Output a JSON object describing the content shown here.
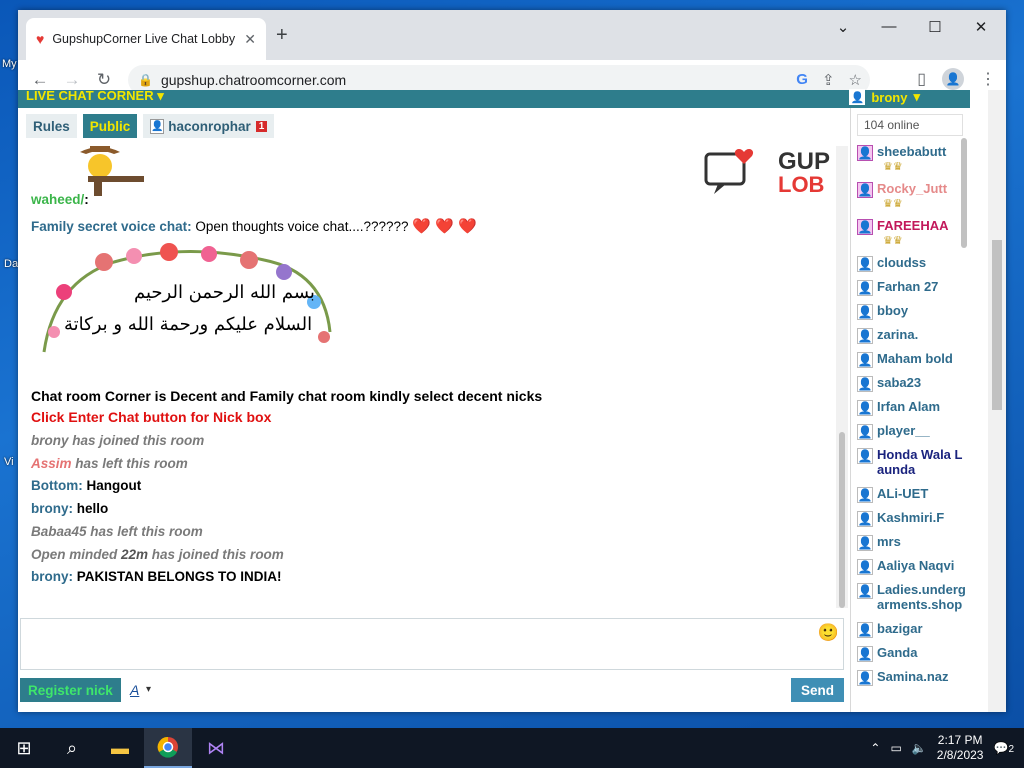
{
  "desktop": {
    "labels": [
      "My",
      "Da",
      "Vi"
    ]
  },
  "browser": {
    "tab_title": "GupshupCorner Live Chat Lobby",
    "url": "gupshup.chatroomcorner.com"
  },
  "site": {
    "brand": "LIVE CHAT CORNER",
    "current_user": "brony",
    "logo_text_top": "GUP",
    "logo_text_bottom": "LOB"
  },
  "chat_tabs": [
    {
      "label": "Rules"
    },
    {
      "label": "Public",
      "active": true
    },
    {
      "label": "haconrophar",
      "badge": "1"
    }
  ],
  "messages": [
    {
      "nick": "waheed/",
      "sep": ":",
      "text": ""
    },
    {
      "nick": "Family secret voice chat",
      "sep": ":",
      "text": " Open thoughts voice chat....??????",
      "extra": "❤️ ❤️ ❤️"
    },
    {
      "text": "Chat room Corner is Decent and Family chat room kindly select decent nicks"
    },
    {
      "text": "Click Enter Chat button for Nick box"
    },
    {
      "text": "brony has joined this room"
    },
    {
      "nick": "Assim",
      "text": " has left this room"
    },
    {
      "nick": "Bottom",
      "sep": ":",
      "text": " Hangout"
    },
    {
      "nick": "brony",
      "sep": ":",
      "text": " hello"
    },
    {
      "text": "Babaa45 has left this room"
    },
    {
      "pre": "Open minded ",
      "bold": "22m",
      "text": " has joined this room"
    },
    {
      "nick": "brony",
      "sep": ":",
      "text": " PAKISTAN BELONGS TO INDIA!"
    }
  ],
  "image_text": {
    "line1": "بسم الله الرحمن الرحیم",
    "line2": "السلام علیکم ورحمة الله و برکاتة"
  },
  "compose": {
    "register_label": "Register nick",
    "font_label": "A",
    "send_label": "Send"
  },
  "userlist": {
    "online_count": "104 online",
    "users": [
      {
        "name": "sheebabutt",
        "gender": "female",
        "crown": true,
        "color": "#2f6b8c"
      },
      {
        "name": "Rocky_Jutt",
        "gender": "female",
        "crown": true,
        "color": "#e58a8a"
      },
      {
        "name": "FAREEHAA",
        "gender": "female",
        "crown": true,
        "color": "#c2185b"
      },
      {
        "name": "cloudss",
        "gender": "male",
        "color": "#2f6b8c"
      },
      {
        "name": "Farhan 27",
        "gender": "male",
        "color": "#2f6b8c"
      },
      {
        "name": "bboy",
        "gender": "male",
        "color": "#2f6b8c"
      },
      {
        "name": "zarina.",
        "gender": "male",
        "color": "#2f6b8c"
      },
      {
        "name": "Maham bold",
        "gender": "male",
        "color": "#2f6b8c"
      },
      {
        "name": "saba23",
        "gender": "male",
        "color": "#2f6b8c"
      },
      {
        "name": "Irfan Alam",
        "gender": "male",
        "color": "#2f6b8c"
      },
      {
        "name": "player__",
        "gender": "male",
        "color": "#2f6b8c"
      },
      {
        "name": "Honda Wala Launda",
        "gender": "male",
        "color": "#1a237e"
      },
      {
        "name": "ALi-UET",
        "gender": "male",
        "color": "#2f6b8c"
      },
      {
        "name": "Kashmiri.F",
        "gender": "male",
        "color": "#2f6b8c"
      },
      {
        "name": "mrs",
        "gender": "male",
        "color": "#2f6b8c"
      },
      {
        "name": "Aaliya Naqvi",
        "gender": "male",
        "color": "#2f6b8c"
      },
      {
        "name": "Ladies.undergarments.shop",
        "gender": "male",
        "color": "#2f6b8c"
      },
      {
        "name": "bazigar",
        "gender": "male",
        "color": "#2f6b8c"
      },
      {
        "name": "Ganda",
        "gender": "male",
        "color": "#2f6b8c"
      },
      {
        "name": "Samina.naz",
        "gender": "male",
        "color": "#2f6b8c"
      }
    ]
  },
  "taskbar": {
    "time": "2:17 PM",
    "date": "2/8/2023",
    "notifications": "2"
  }
}
